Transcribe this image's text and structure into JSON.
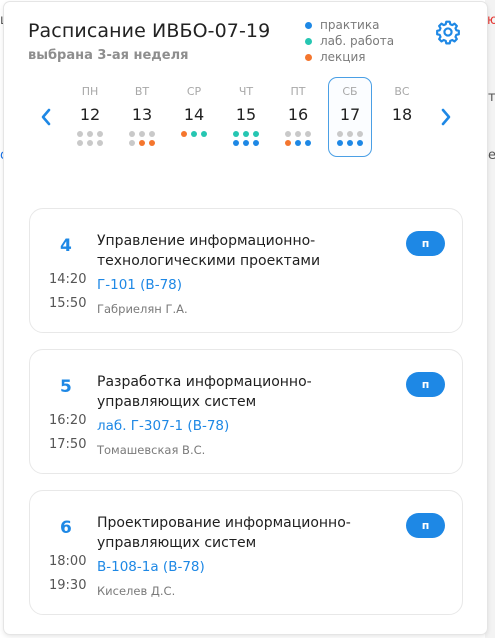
{
  "colors": {
    "practice": "#1e88e5",
    "lab": "#26c6b2",
    "lecture": "#f4762e",
    "empty": "#c9c9c9",
    "accent": "#1e88e5"
  },
  "background": {
    "left_top": "ц",
    "right_top": "ю",
    "left_mid": "о",
    "right_mid1": "ти",
    "right_mid2": "ер"
  },
  "header": {
    "title": "Расписание ИВБО-07-19",
    "subtitle": "выбрана 3-ая неделя",
    "settings_icon": "gear-icon"
  },
  "legend": [
    {
      "label": "практика",
      "color": "#1e88e5"
    },
    {
      "label": "лаб. работа",
      "color": "#26c6b2"
    },
    {
      "label": "лекция",
      "color": "#f4762e"
    }
  ],
  "week": {
    "prev_icon": "chevron-left-icon",
    "next_icon": "chevron-right-icon",
    "selected_index": 5,
    "days": [
      {
        "name": "ПН",
        "num": "12",
        "dots": [
          "e",
          "e",
          "e",
          "e",
          "e",
          "e"
        ]
      },
      {
        "name": "ВТ",
        "num": "13",
        "dots": [
          "e",
          "e",
          "e",
          "e",
          "lec",
          "lec"
        ]
      },
      {
        "name": "СР",
        "num": "14",
        "dots": [
          "lec",
          "lab",
          "lab"
        ]
      },
      {
        "name": "ЧТ",
        "num": "15",
        "dots": [
          "lab",
          "lab",
          "lab",
          "pr",
          "pr",
          "pr"
        ]
      },
      {
        "name": "ПТ",
        "num": "16",
        "dots": [
          "e",
          "e",
          "e",
          "lec",
          "pr",
          "pr"
        ]
      },
      {
        "name": "СБ",
        "num": "17",
        "dots": [
          "e",
          "e",
          "e",
          "pr",
          "pr",
          "pr"
        ]
      },
      {
        "name": "ВС",
        "num": "18",
        "dots": []
      }
    ]
  },
  "lessons": [
    {
      "num": "4",
      "start": "14:20",
      "end": "15:50",
      "subject": "Управление информационно-технологическими проектами",
      "room": "Г-101 (В-78)",
      "teacher": "Габриелян Г.А.",
      "badge": "п"
    },
    {
      "num": "5",
      "start": "16:20",
      "end": "17:50",
      "subject": "Разработка информационно-управляющих систем",
      "room": "лаб. Г-307-1 (В-78)",
      "teacher": "Томашевская В.С.",
      "badge": "п"
    },
    {
      "num": "6",
      "start": "18:00",
      "end": "19:30",
      "subject": "Проектирование информационно-управляющих систем",
      "room": "В-108-1а (В-78)",
      "teacher": "Киселев Д.С.",
      "badge": "п"
    }
  ]
}
